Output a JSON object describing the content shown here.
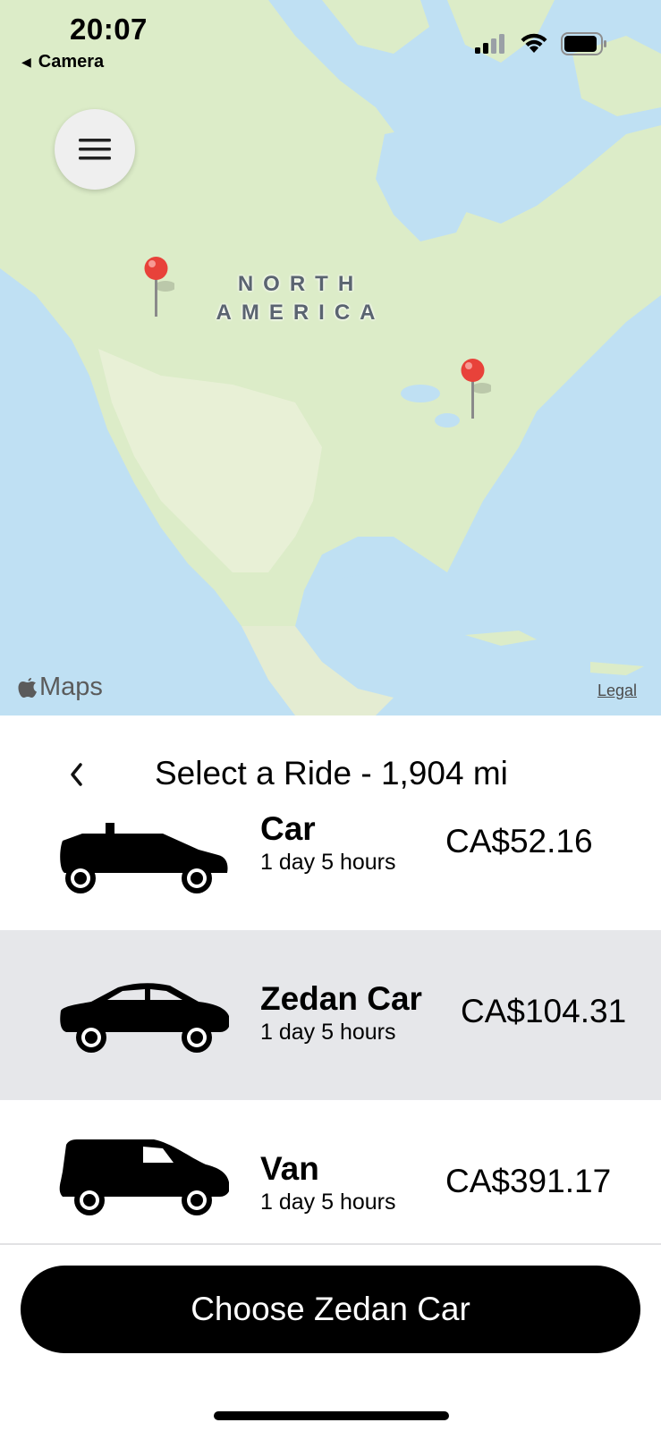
{
  "status": {
    "time": "20:07",
    "back_app": "Camera"
  },
  "map": {
    "region_label_line1": "NORTH",
    "region_label_line2": "AMERICA",
    "attribution": "Maps",
    "legal": "Legal",
    "colors": {
      "water": "#bfe0f3",
      "land": "#dcecc8",
      "pin": "#e8423a"
    }
  },
  "sheet": {
    "title": "Select a Ride - 1,904 mi",
    "rides": [
      {
        "name": "Car",
        "eta": "1 day 5 hours",
        "price": "CA$52.16",
        "icon": "hatchback-car-icon",
        "selected": false
      },
      {
        "name": "Zedan Car",
        "eta": "1 day 5 hours",
        "price": "CA$104.31",
        "icon": "sedan-car-icon",
        "selected": true
      },
      {
        "name": "Van",
        "eta": "1 day 5 hours",
        "price": "CA$391.17",
        "icon": "van-icon",
        "selected": false
      }
    ],
    "choose_button": "Choose Zedan Car"
  }
}
